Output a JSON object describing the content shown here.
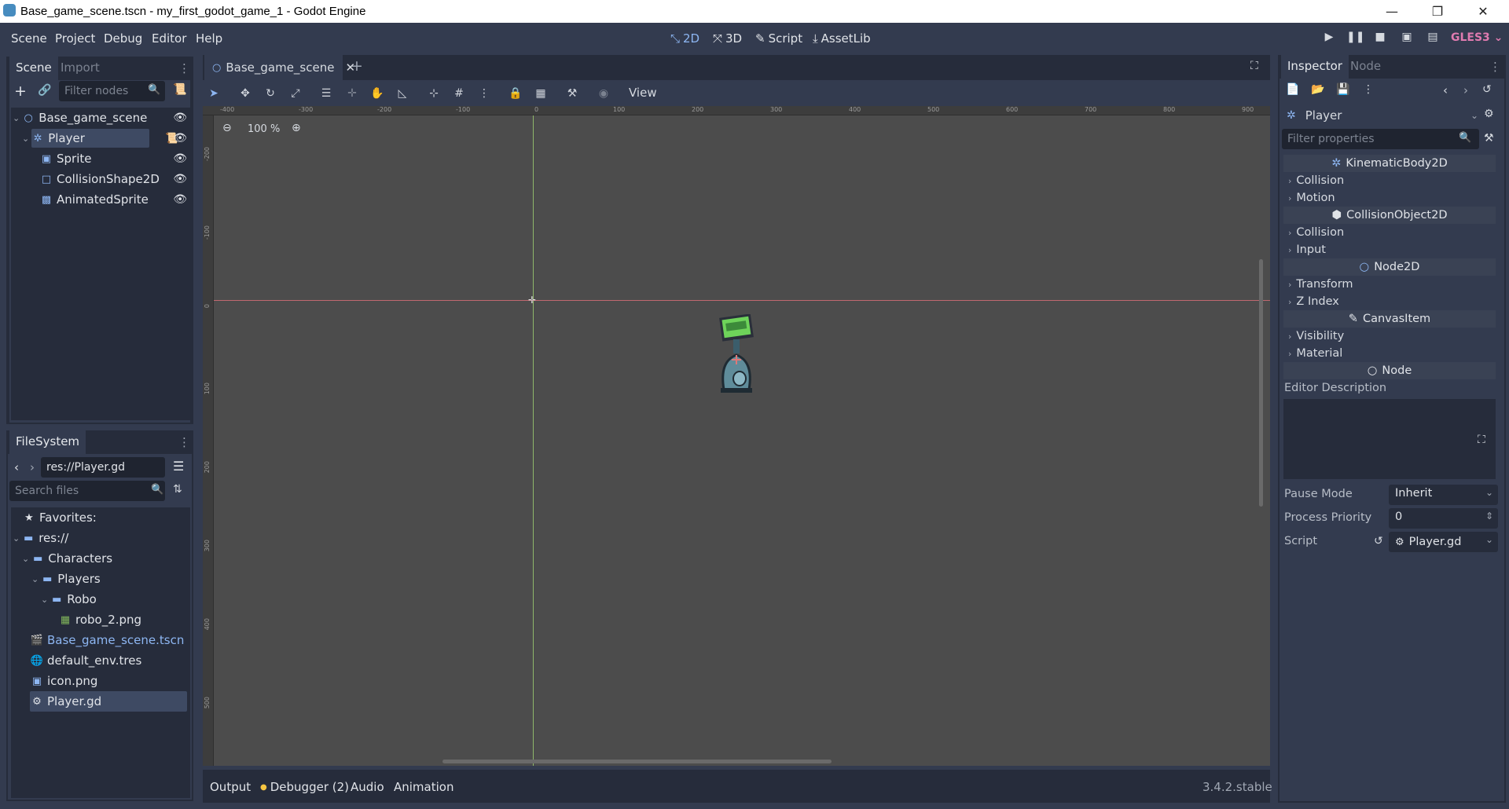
{
  "window": {
    "title": "Base_game_scene.tscn - my_first_godot_game_1 - Godot Engine",
    "minimize": "—",
    "maximize": "❐",
    "close": "✕"
  },
  "menu": [
    "Scene",
    "Project",
    "Debug",
    "Editor",
    "Help"
  ],
  "workspaces": {
    "w2d": "2D",
    "w3d": "3D",
    "script": "Script",
    "assetlib": "AssetLib"
  },
  "renderer": "GLES3 ⌄",
  "scene_dock": {
    "tabs": {
      "scene": "Scene",
      "import": "Import"
    },
    "filter_placeholder": "Filter nodes",
    "nodes": [
      {
        "label": "Base_game_scene",
        "icon": "node2d-icon"
      },
      {
        "label": "Player",
        "icon": "kinematic-body-icon"
      },
      {
        "label": "Sprite",
        "icon": "sprite-icon"
      },
      {
        "label": "CollisionShape2D",
        "icon": "collision-shape-icon"
      },
      {
        "label": "AnimatedSprite",
        "icon": "animated-sprite-icon"
      }
    ]
  },
  "filesystem": {
    "tab": "FileSystem",
    "path": "res://Player.gd",
    "search_placeholder": "Search files",
    "items": [
      {
        "label": "Favorites:"
      },
      {
        "label": "res://"
      },
      {
        "label": "Characters"
      },
      {
        "label": "Players"
      },
      {
        "label": "Robo"
      },
      {
        "label": "robo_2.png"
      },
      {
        "label": "Base_game_scene.tscn"
      },
      {
        "label": "default_env.tres"
      },
      {
        "label": "icon.png"
      },
      {
        "label": "Player.gd"
      }
    ]
  },
  "editor": {
    "scene_tab": "Base_game_scene",
    "view_menu": "View",
    "zoom": "100 %",
    "ruler_top": [
      "-400",
      "-300",
      "-200",
      "-100",
      "0",
      "100",
      "200",
      "300",
      "400",
      "500",
      "600",
      "700",
      "800",
      "900"
    ],
    "ruler_left": [
      "-200",
      "-100",
      "0",
      "100",
      "200",
      "300",
      "400",
      "500"
    ]
  },
  "bottom": {
    "output": "Output",
    "debugger": "Debugger (2)",
    "audio": "Audio",
    "animation": "Animation",
    "version": "3.4.2.stable"
  },
  "inspector": {
    "tabs": {
      "inspector": "Inspector",
      "node": "Node"
    },
    "object": "Player",
    "filter_placeholder": "Filter properties",
    "sections": [
      {
        "label": "KinematicBody2D",
        "type": "category"
      },
      {
        "label": "Collision",
        "type": "group"
      },
      {
        "label": "Motion",
        "type": "group"
      },
      {
        "label": "CollisionObject2D",
        "type": "category"
      },
      {
        "label": "Collision",
        "type": "group"
      },
      {
        "label": "Input",
        "type": "group"
      },
      {
        "label": "Node2D",
        "type": "category"
      },
      {
        "label": "Transform",
        "type": "group"
      },
      {
        "label": "Z Index",
        "type": "group"
      },
      {
        "label": "CanvasItem",
        "type": "category"
      },
      {
        "label": "Visibility",
        "type": "group"
      },
      {
        "label": "Material",
        "type": "group"
      },
      {
        "label": "Node",
        "type": "category"
      }
    ],
    "editor_description_label": "Editor Description",
    "pause_mode": {
      "label": "Pause Mode",
      "value": "Inherit"
    },
    "process_priority": {
      "label": "Process Priority",
      "value": "0"
    },
    "script": {
      "label": "Script",
      "value": "Player.gd"
    }
  },
  "colors": {
    "accent": "#8db6f2",
    "panel": "#262c3b",
    "background": "#333b4f",
    "viewport": "#4c4c4c",
    "gles": "#e07bb0"
  }
}
